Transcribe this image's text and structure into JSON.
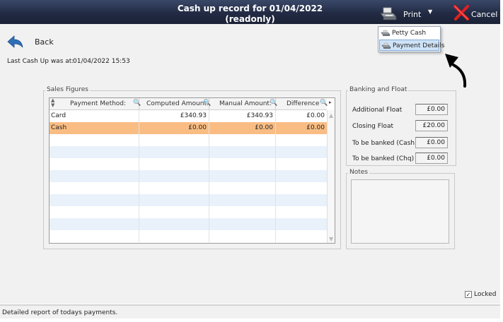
{
  "title": {
    "line1": "Cash up record for 01/04/2022",
    "line2": "(readonly)"
  },
  "toolbar": {
    "print_label": "Print",
    "cancel_label": "Cancel"
  },
  "print_menu": {
    "items": [
      {
        "label": "Petty Cash",
        "icon": "printer-icon",
        "highlighted": false
      },
      {
        "label": "Payment Details",
        "icon": "printer-icon",
        "highlighted": true
      }
    ]
  },
  "back": {
    "label": "Back"
  },
  "last_cash_up": {
    "label": "Last Cash Up was at:",
    "value": "01/04/2022 15:53"
  },
  "sales_figures": {
    "title": "Sales Figures",
    "columns": [
      "Payment Method:",
      "Computed Amount:",
      "Manual Amount:",
      "Difference"
    ],
    "rows": [
      {
        "method": "Card",
        "computed": "£340.93",
        "manual": "£340.93",
        "difference": "£0.00",
        "selected": false
      },
      {
        "method": "Cash",
        "computed": "£0.00",
        "manual": "£0.00",
        "difference": "£0.00",
        "selected": true
      }
    ]
  },
  "banking": {
    "title": "Banking and Float",
    "fields": [
      {
        "label": "Additional Float",
        "value": "£0.00"
      },
      {
        "label": "Closing  Float",
        "value": "£20.00"
      },
      {
        "label": "To be banked (Cash)",
        "value": "£0.00"
      },
      {
        "label": "To be banked (Chq)",
        "value": "£0.00"
      }
    ]
  },
  "notes": {
    "title": "Notes"
  },
  "locked": {
    "label": "Locked",
    "checked": true,
    "mark": "✓"
  },
  "status_bar": {
    "text": "Detailed report of todays payments."
  },
  "colors": {
    "titlebar": "#222b44",
    "selected_row": "#f9bd84",
    "alt_row": "#e9f1fb",
    "menu_highlight": "#cfe3f7"
  }
}
